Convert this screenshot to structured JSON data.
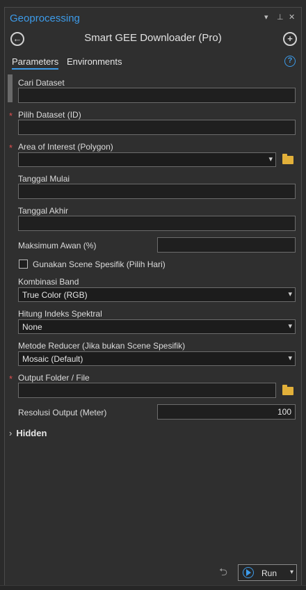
{
  "window": {
    "title": "Geoprocessing",
    "controls": {
      "menu": "▾",
      "pin": "⊥",
      "close": "✕"
    }
  },
  "tool": {
    "title": "Smart GEE Downloader (Pro)"
  },
  "tabs": [
    {
      "label": "Parameters",
      "active": true
    },
    {
      "label": "Environments",
      "active": false
    }
  ],
  "params": {
    "cari_dataset": {
      "label": "Cari Dataset",
      "value": ""
    },
    "pilih_dataset": {
      "label": "Pilih Dataset (ID)",
      "value": "",
      "required": "*"
    },
    "aoi": {
      "label": "Area of Interest (Polygon)",
      "value": "",
      "required": "*"
    },
    "tanggal_mulai": {
      "label": "Tanggal Mulai",
      "value": ""
    },
    "tanggal_akhir": {
      "label": "Tanggal Akhir",
      "value": ""
    },
    "maks_awan": {
      "label": "Maksimum Awan (%)",
      "value": ""
    },
    "scene_spesifik": {
      "label": "Gunakan Scene Spesifik (Pilih Hari)",
      "checked": false
    },
    "kombinasi_band": {
      "label": "Kombinasi Band",
      "value": "True Color (RGB)"
    },
    "indeks_spektral": {
      "label": "Hitung Indeks Spektral",
      "value": "None"
    },
    "metode_reducer": {
      "label": "Metode Reducer (Jika bukan Scene Spesifik)",
      "value": "Mosaic (Default)"
    },
    "output_folder": {
      "label": "Output Folder / File",
      "value": "",
      "required": "*"
    },
    "resolusi": {
      "label": "Resolusi Output (Meter)",
      "value": "100"
    }
  },
  "hidden_section": {
    "label": "Hidden"
  },
  "run_button": {
    "label": "Run"
  },
  "colors": {
    "accent": "#3d9be9",
    "required": "#e05050",
    "folder": "#e2b03a"
  }
}
